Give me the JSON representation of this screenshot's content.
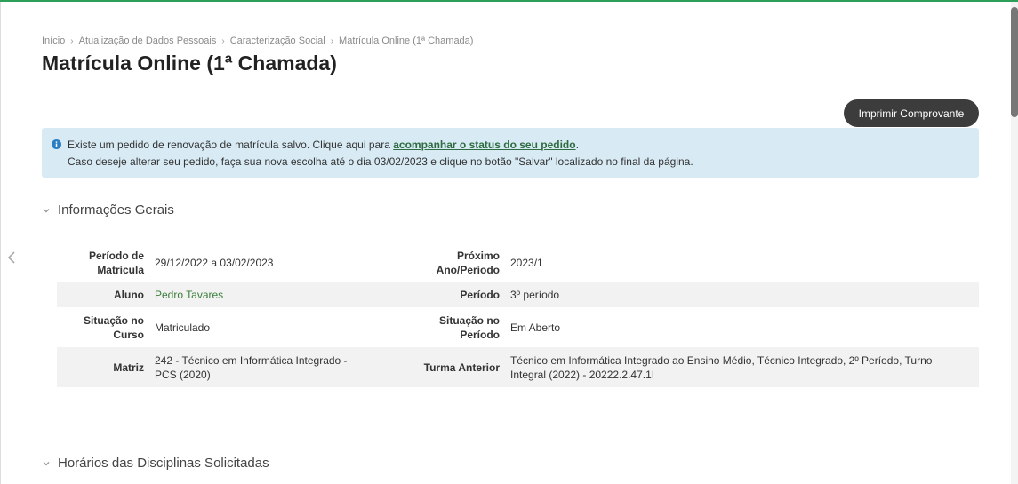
{
  "breadcrumb": [
    "Início",
    "Atualização de Dados Pessoais",
    "Caracterização Social",
    "Matrícula Online (1ª Chamada)"
  ],
  "page_title": "Matrícula Online (1ª Chamada)",
  "print_button": "Imprimir Comprovante",
  "alert": {
    "line1_prefix": "Existe um pedido de renovação de matrícula salvo. Clique aqui para ",
    "link": "acompanhar o status do seu pedido",
    "line1_suffix": ".",
    "line2": "Caso deseje alterar seu pedido, faça sua nova escolha até o dia 03/02/2023 e clique no botão \"Salvar\" localizado no final da página."
  },
  "sections": {
    "general": "Informações Gerais",
    "schedule": "Horários das Disciplinas Solicitadas"
  },
  "info": {
    "periodo_matricula_label_1": "Período de",
    "periodo_matricula_label_2": "Matrícula",
    "periodo_matricula": "29/12/2022 a 03/02/2023",
    "proximo_label_1": "Próximo",
    "proximo_label_2": "Ano/Período",
    "proximo": "2023/1",
    "aluno_label": "Aluno",
    "aluno": "Pedro Tavares",
    "periodo_label": "Período",
    "periodo": "3º período",
    "situacao_curso_label_1": "Situação no",
    "situacao_curso_label_2": "Curso",
    "situacao_curso": "Matriculado",
    "situacao_periodo_label_1": "Situação no",
    "situacao_periodo_label_2": "Período",
    "situacao_periodo": "Em Aberto",
    "matriz_label": "Matriz",
    "matriz_1": "242 - Técnico em Informática Integrado -",
    "matriz_2": "PCS (2020)",
    "turma_label": "Turma Anterior",
    "turma_1": "Técnico em Informática Integrado ao Ensino Médio, Técnico Integrado, 2º Período, Turno",
    "turma_2": "Integral (2022) - 20222.2.47.1I"
  },
  "colors": {
    "accent_green": "#2e9e5b",
    "alert_bg": "#d8ebf5",
    "link_green": "#2e6b3f",
    "button_bg": "#3c3c3c"
  }
}
